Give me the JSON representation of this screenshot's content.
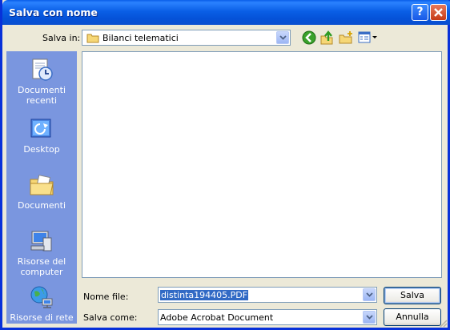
{
  "window": {
    "title": "Salva con nome"
  },
  "lookin": {
    "label": "Salva in:",
    "value": "Bilanci telematici"
  },
  "toolbar": {
    "back_icon": "back-arrow-icon",
    "up_icon": "up-folder-icon",
    "newfolder_icon": "new-folder-icon",
    "views_icon": "views-menu-icon"
  },
  "places": [
    {
      "label": "Documenti recenti",
      "icon": "recent-documents-icon"
    },
    {
      "label": "Desktop",
      "icon": "desktop-icon"
    },
    {
      "label": "Documenti",
      "icon": "documents-folder-icon"
    },
    {
      "label": "Risorse del computer",
      "icon": "my-computer-icon"
    },
    {
      "label": "Risorse di rete",
      "icon": "network-icon"
    }
  ],
  "filename": {
    "label": "Nome file:",
    "value": "distinta194405.PDF"
  },
  "filetype": {
    "label": "Salva come:",
    "value": "Adobe Acrobat Document"
  },
  "buttons": {
    "save": "Salva",
    "cancel": "Annulla"
  },
  "colors": {
    "titlebar": "#0a5fe6",
    "places_bg": "#7a96df",
    "dialog_bg": "#ece9d8",
    "selection": "#316ac5"
  }
}
